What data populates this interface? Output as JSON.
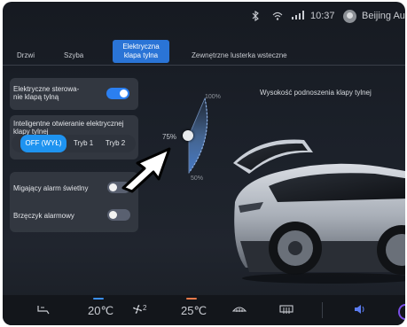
{
  "status": {
    "bluetooth_icon": "bluetooth-icon",
    "wifi_icon": "wifi-icon",
    "signal_icon": "signal-icon",
    "time": "10:37",
    "location": "Beijing Au"
  },
  "tabs": [
    {
      "label": "Drzwi"
    },
    {
      "label": "Szyba"
    },
    {
      "label_line1": "Elektryczna",
      "label_line2": "klapa tylna"
    },
    {
      "label": "Zewnętrzne lusterka wsteczne"
    }
  ],
  "panel_tailgate": {
    "label": "Elektryczne sterowa-nie klapą tylną",
    "toggle_state": "on"
  },
  "panel_smart": {
    "label": "Inteligentne otwieranie elektrycznej klapy tylnej",
    "modes": [
      "OFF (WYŁ)",
      "Tryb 1",
      "Tryb 2"
    ],
    "selected_mode": "OFF (WYŁ)"
  },
  "panel_alarms": {
    "alarm_light_label": "Migający alarm świetlny",
    "alarm_light_state": "off",
    "buzzer_label": "Brzęczyk alarmowy",
    "buzzer_state": "off"
  },
  "gauge": {
    "title": "Wysokość podnoszenia klapy tylnej",
    "label_max": "100%",
    "label_current": "75%",
    "label_min": "50%",
    "value_percent": 75
  },
  "bottom_bar": {
    "seat_icon": "seat-heat-icon",
    "temp_left": "20℃",
    "fan_label": "2",
    "temp_right": "25℃",
    "front_defrost_icon": "front-defrost-icon",
    "rear_defrost_icon": "rear-defrost-icon",
    "volume_icon": "volume-icon"
  },
  "colors": {
    "accent_blue": "#2b7ff0",
    "accent_orange": "#e87a4a",
    "background": "#1b2029"
  }
}
